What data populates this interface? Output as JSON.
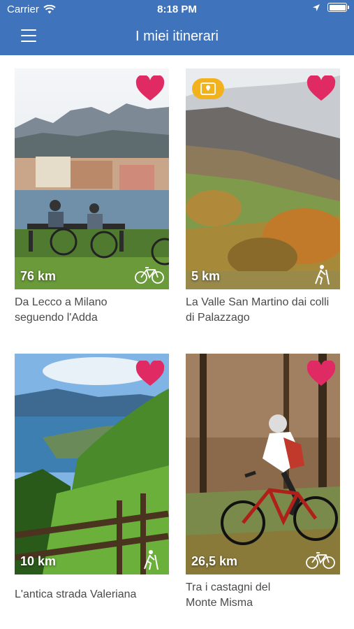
{
  "status_bar": {
    "carrier": "Carrier",
    "time": "8:18 PM"
  },
  "nav": {
    "title": "I miei itinerari",
    "menu_icon": "hamburger-icon"
  },
  "colors": {
    "header": "#3f73bb",
    "heart": "#e02a63",
    "map_badge": "#f2b21e"
  },
  "cards": [
    {
      "distance": "76 km",
      "title_line1": "Da Lecco a Milano",
      "title_line2": "seguendo l'Adda",
      "type_icon": "bike-icon",
      "favorite": true,
      "map_badge": false
    },
    {
      "distance": "5 km",
      "title_line1": "La Valle San Martino dai colli",
      "title_line2": "di Palazzago",
      "type_icon": "hiker-icon",
      "favorite": true,
      "map_badge": true
    },
    {
      "distance": "10 km",
      "title_line1": "L'antica strada Valeriana",
      "title_line2": "",
      "type_icon": "hiker-icon",
      "favorite": true,
      "map_badge": false
    },
    {
      "distance": "26,5 km",
      "title_line1": "Tra i castagni del",
      "title_line2": "Monte Misma",
      "type_icon": "bike-icon",
      "favorite": true,
      "map_badge": false
    }
  ]
}
